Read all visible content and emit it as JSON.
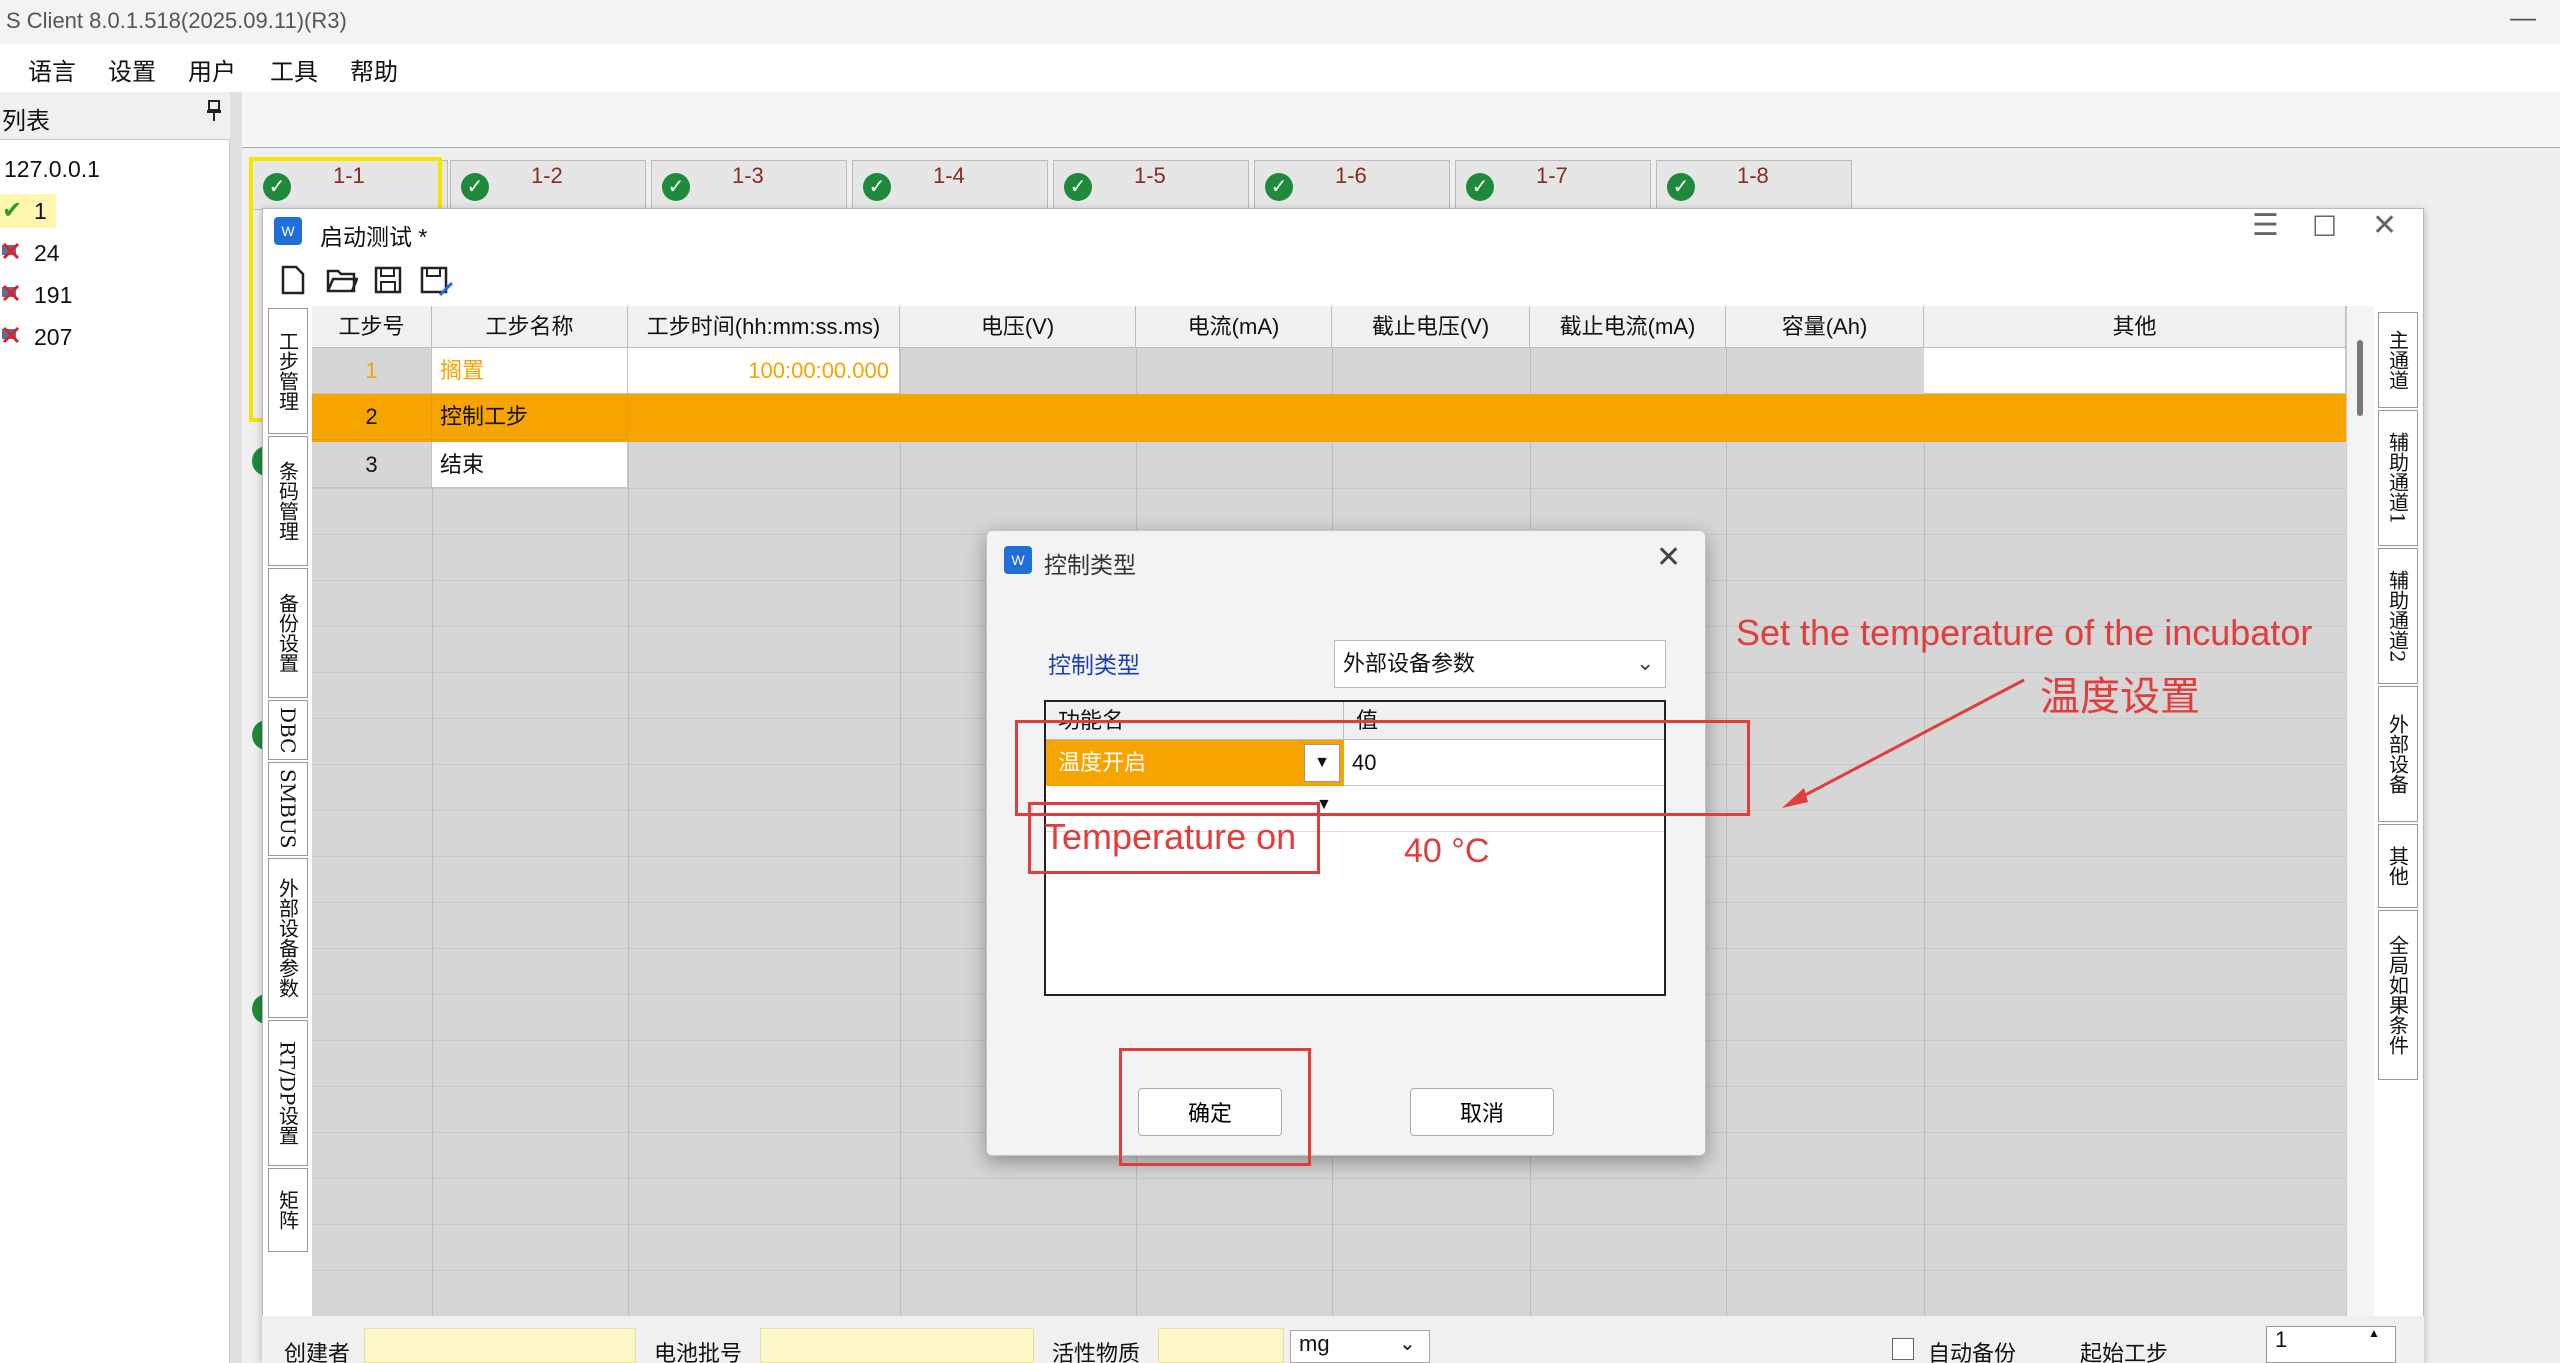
{
  "app": {
    "title": "S Client 8.0.1.518(2025.09.11)(R3)",
    "minimize": "—"
  },
  "menu": [
    "语言",
    "设置",
    "用户",
    "工具",
    "帮助"
  ],
  "left": {
    "title": "列表",
    "pin": "📌",
    "ip": "127.0.0.1",
    "devices": [
      "1",
      "24",
      "191",
      "207"
    ]
  },
  "tabs": [
    "1-1",
    "1-2",
    "1-3",
    "1-4",
    "1-5",
    "1-6",
    "1-7",
    "1-8"
  ],
  "step_window": {
    "title": "启动测试 *",
    "menu_icon": "☰",
    "max_icon": "☐",
    "close_icon": "✕",
    "columns": [
      "工步号",
      "工步名称",
      "工步时间(hh:mm:ss.ms)",
      "电压(V)",
      "电流(mA)",
      "截止电压(V)",
      "截止电流(mA)",
      "容量(Ah)",
      "其他"
    ],
    "rows": [
      {
        "no": "1",
        "name": "搁置",
        "time": "100:00:00.000"
      },
      {
        "no": "2",
        "name": "控制工步",
        "time": ""
      },
      {
        "no": "3",
        "name": "结束",
        "time": ""
      }
    ],
    "left_tabs": [
      "工步管理",
      "条码管理",
      "备份设置",
      "DBC",
      "SMBUS",
      "外部设备参数",
      "RT/DP设置",
      "矩阵"
    ],
    "right_tabs": [
      "主通道",
      "辅助通道1",
      "辅助通道2",
      "外部设备",
      "其他",
      "全局如果条件"
    ]
  },
  "bottom": {
    "creator": "创建者",
    "batch": "电池批号",
    "active": "活性物质",
    "unit": "mg",
    "auto_backup": "自动备份",
    "start_step": "起始工步",
    "start_value": "1"
  },
  "dialog": {
    "title": "控制类型",
    "close": "✕",
    "ctl_label": "控制类型",
    "ctl_value": "外部设备参数",
    "col_name": "功能名",
    "col_value": "值",
    "func": "温度开启",
    "value": "40",
    "ok": "确定",
    "cancel": "取消"
  },
  "annotations": {
    "set_temp": "Set the temperature of the incubator",
    "temp_cn": "温度设置",
    "temp_on": "Temperature on",
    "temp_40": "40 °C"
  },
  "colors": {
    "accent": "#f6a400",
    "annotation": "#e23d3d",
    "check": "#1f8a3b"
  }
}
